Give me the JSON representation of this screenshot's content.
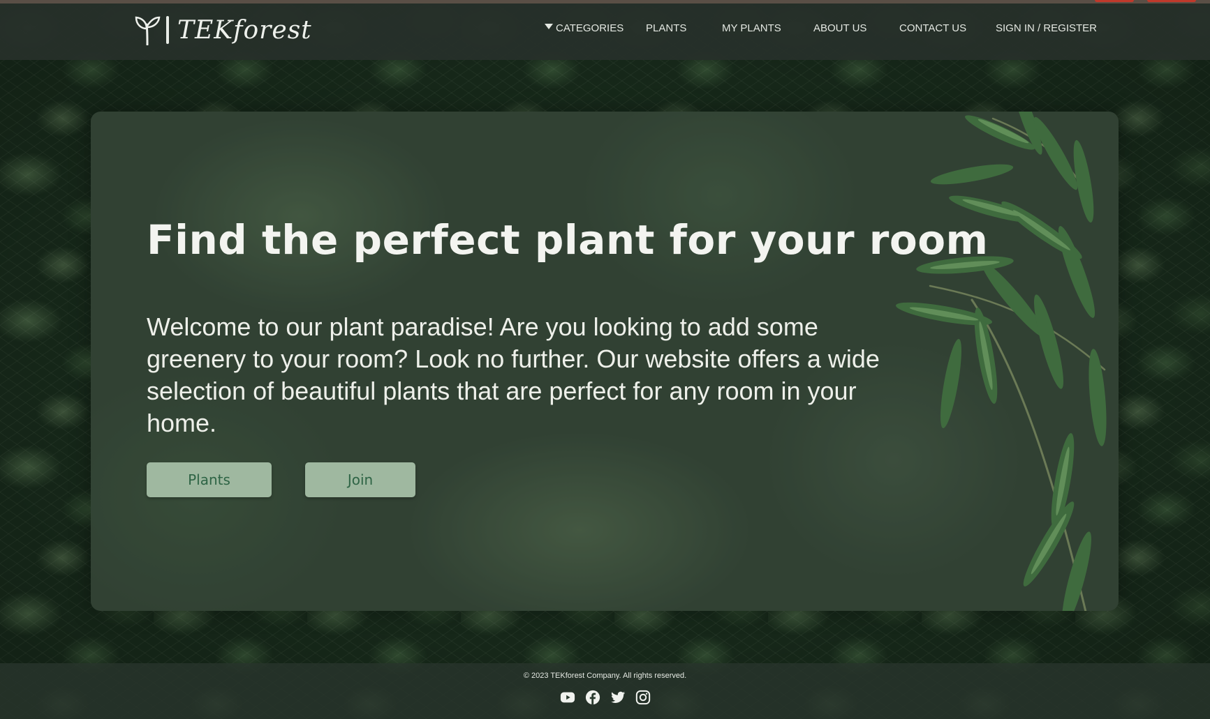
{
  "brand": {
    "name": "TEKforest"
  },
  "nav": {
    "categories": "CATEGORIES",
    "plants": "PLANTS",
    "my_plants": "MY PLANTS",
    "about": "ABOUT US",
    "contact": "CONTACT US",
    "signin": "SIGN IN / REGISTER"
  },
  "hero": {
    "title": "Find the perfect plant for your room",
    "text": "Welcome to our plant paradise! Are you looking to add some greenery to your room? Look no further. Our website offers a wide selection of beautiful plants that are perfect for any room in your home.",
    "buttons": {
      "plants": "Plants",
      "join": "Join"
    }
  },
  "footer": {
    "copyright": "© 2023 TEKforest Company. All rights reserved.",
    "socials": [
      "youtube-icon",
      "facebook-icon",
      "twitter-icon",
      "instagram-icon"
    ]
  },
  "colors": {
    "header_bg": "#26302a",
    "button_bg": "#9fb8a0",
    "button_text": "#2e6445",
    "text": "#f3f4f0"
  }
}
